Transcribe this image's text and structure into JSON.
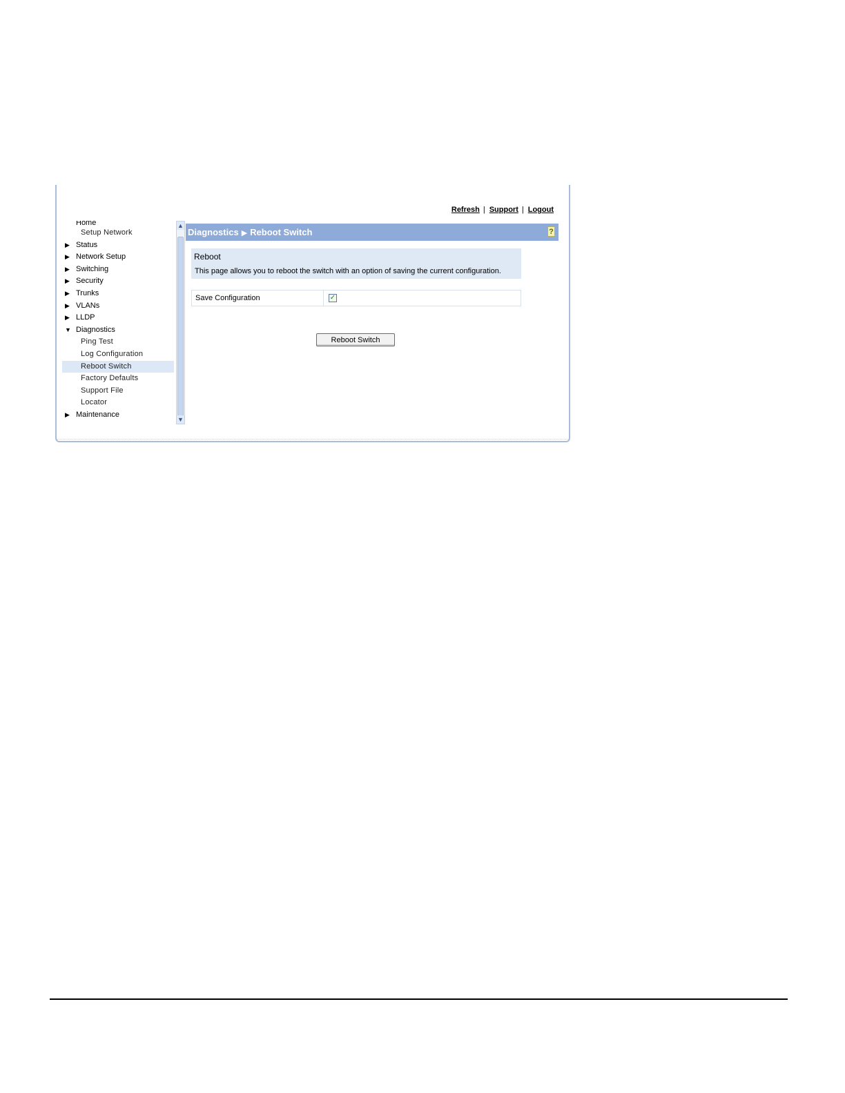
{
  "header": {
    "links": [
      "Refresh",
      "Support",
      "Logout"
    ],
    "separator": "|"
  },
  "sidebar": {
    "items": [
      {
        "label": "Home",
        "type": "top",
        "cut": true
      },
      {
        "label": "Setup Network",
        "type": "sub"
      },
      {
        "label": "Status",
        "type": "top",
        "icon": "triangle-right-icon"
      },
      {
        "label": "Network Setup",
        "type": "top",
        "icon": "triangle-right-icon"
      },
      {
        "label": "Switching",
        "type": "top",
        "icon": "triangle-right-icon"
      },
      {
        "label": "Security",
        "type": "top",
        "icon": "triangle-right-icon"
      },
      {
        "label": "Trunks",
        "type": "top",
        "icon": "triangle-right-icon"
      },
      {
        "label": "VLANs",
        "type": "top",
        "icon": "triangle-right-icon"
      },
      {
        "label": "LLDP",
        "type": "top",
        "icon": "triangle-right-icon"
      },
      {
        "label": "Diagnostics",
        "type": "top",
        "icon": "triangle-down-icon",
        "expanded": true
      },
      {
        "label": "Ping Test",
        "type": "sub"
      },
      {
        "label": "Log Configuration",
        "type": "sub"
      },
      {
        "label": "Reboot Switch",
        "type": "sub",
        "selected": true
      },
      {
        "label": "Factory Defaults",
        "type": "sub"
      },
      {
        "label": "Support File",
        "type": "sub"
      },
      {
        "label": "Locator",
        "type": "sub"
      },
      {
        "label": "Maintenance",
        "type": "top",
        "icon": "triangle-right-icon"
      }
    ]
  },
  "content": {
    "breadcrumb": {
      "section": "Diagnostics",
      "arrow": "▶",
      "page": "Reboot Switch"
    },
    "help_icon": "?",
    "info": {
      "heading": "Reboot",
      "description": "This page allows you to reboot the switch with an option of saving the current configuration."
    },
    "settings": [
      {
        "label": "Save Configuration",
        "checked": true,
        "check_glyph": "✓"
      }
    ],
    "button_label": "Reboot Switch"
  },
  "colors": {
    "titlebar": "#8eaad8",
    "infobox": "#dfe8f5",
    "selected_item": "#dde8f7"
  }
}
